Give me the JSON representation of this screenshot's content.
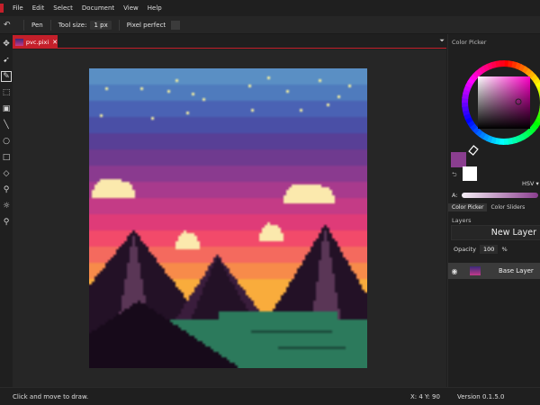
{
  "menu": [
    "File",
    "Edit",
    "Select",
    "Document",
    "View",
    "Help"
  ],
  "tool_options": {
    "tool_name": "Pen",
    "tool_size_label": "Tool size:",
    "tool_size_value": "1 px",
    "pixel_perfect_label": "Pixel perfect",
    "pixel_perfect_checked": false
  },
  "toolbar": {
    "tools": [
      {
        "icon": "move-icon",
        "glyph": "✥"
      },
      {
        "icon": "pointer-icon",
        "glyph": "➹"
      },
      {
        "icon": "pen-icon",
        "glyph": "✎",
        "active": true
      },
      {
        "icon": "select-icon",
        "glyph": "⬚"
      },
      {
        "icon": "bucket-icon",
        "glyph": "▣"
      },
      {
        "icon": "line-icon",
        "glyph": "╲"
      },
      {
        "icon": "circle-icon",
        "glyph": "○"
      },
      {
        "icon": "rectangle-icon",
        "glyph": "□"
      },
      {
        "icon": "eraser-icon",
        "glyph": "◇"
      },
      {
        "icon": "color-picker-icon",
        "glyph": "⚲"
      },
      {
        "icon": "brightness-icon",
        "glyph": "☼"
      },
      {
        "icon": "zoom-icon",
        "glyph": "⚲"
      }
    ]
  },
  "document_tab": {
    "name": "pvc.pixi",
    "close_glyph": "✕"
  },
  "tab_menu_glyph": "⏷",
  "color_picker": {
    "title": "Color Picker",
    "primary_color": "#8a3e8f",
    "secondary_color": "#ffffff",
    "mode": "HSV",
    "alpha_label": "A:",
    "tabs": [
      "Color Picker",
      "Color Sliders"
    ],
    "active_tab": 0
  },
  "layers": {
    "title": "Layers",
    "new_layer_label": "New Layer",
    "opacity_label": "Opacity",
    "opacity_value": "100",
    "opacity_unit": "%",
    "items": [
      {
        "name": "Base Layer",
        "visible": true
      }
    ]
  },
  "artwork": {
    "sky_colors": [
      "#5a8fc4",
      "#4f7bbd",
      "#4a62b4",
      "#4a4fa6",
      "#583f96",
      "#6f3a8f",
      "#8a3a8f",
      "#a83a8d",
      "#c43b86",
      "#df3b78",
      "#f24a6a",
      "#f46a5e",
      "#f78b4a",
      "#f9ac3c"
    ],
    "star_color": "#f6f0a0",
    "cloud_color": "#fbe9ad",
    "mountain_dark": "#231126",
    "mountain_mid": "#3a1d3c",
    "mountain_light": "#5a3656",
    "lake_color": "#2c7a5c",
    "lake_dark": "#1d4f3e",
    "foreground_dark": "#170a1a"
  },
  "status": {
    "message": "Click and move to draw.",
    "coords": "X: 4  Y: 90",
    "version": "Version 0.1.5.0"
  }
}
